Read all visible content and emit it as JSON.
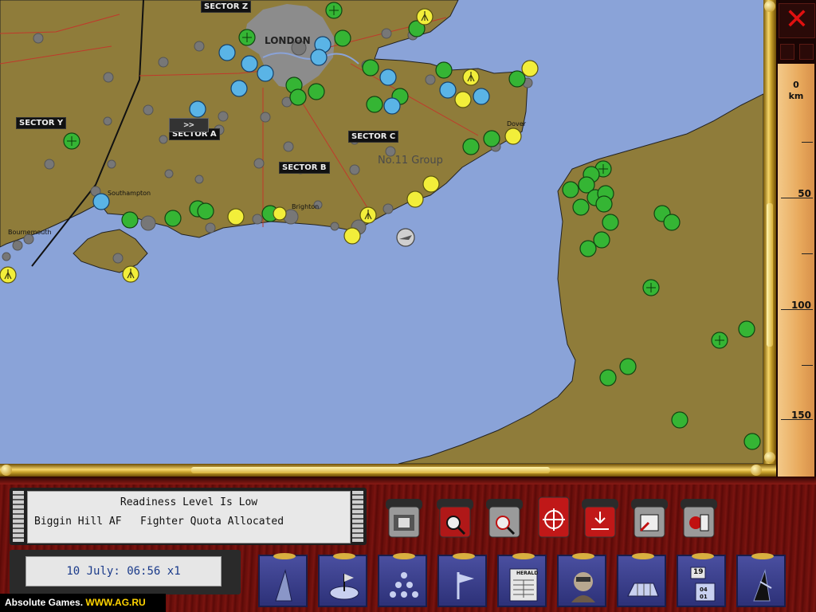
{
  "map": {
    "sectors": [
      "SECTOR Z",
      "SECTOR Y",
      "SECTOR A",
      "SECTOR C",
      "SECTOR B"
    ],
    "city": "LONDON",
    "group": "No.11 Group",
    "towns": [
      "Southampton",
      "Bournemouth",
      "Brighton",
      "Dover"
    ]
  },
  "scale": {
    "unit_top": "0",
    "unit_bottom": "km",
    "ticks": [
      "50",
      "100",
      "150"
    ]
  },
  "window": {
    "close_symbol": "✕"
  },
  "messages": {
    "title": "Readiness Level Is Low",
    "body": "Biggin Hill AF   Fighter Quota Allocated"
  },
  "clock": {
    "text": "10 July: 06:56 x1",
    "fast_forward": ">>"
  },
  "nav_icons": {
    "herald": "HERALD",
    "calendar_day": "19",
    "calendar_line1": "04",
    "calendar_line2": "01"
  },
  "watermark": {
    "prefix": "Absolute Games. ",
    "site": "WWW.AG.RU"
  },
  "icons": [
    "airfield-icon",
    "factory-icon",
    "radar-icon",
    "anti-aircraft-icon",
    "briefcase-icon",
    "map-zoom-icon",
    "search-icon",
    "target-icon",
    "download-icon",
    "save-icon",
    "exit-icon",
    "plane-tail-icon",
    "airfield-map-icon",
    "squadron-formation-icon",
    "flag-icon",
    "newspaper-icon",
    "pilot-portrait-icon",
    "hangar-icon",
    "calendar-icon",
    "navigation-icon"
  ]
}
